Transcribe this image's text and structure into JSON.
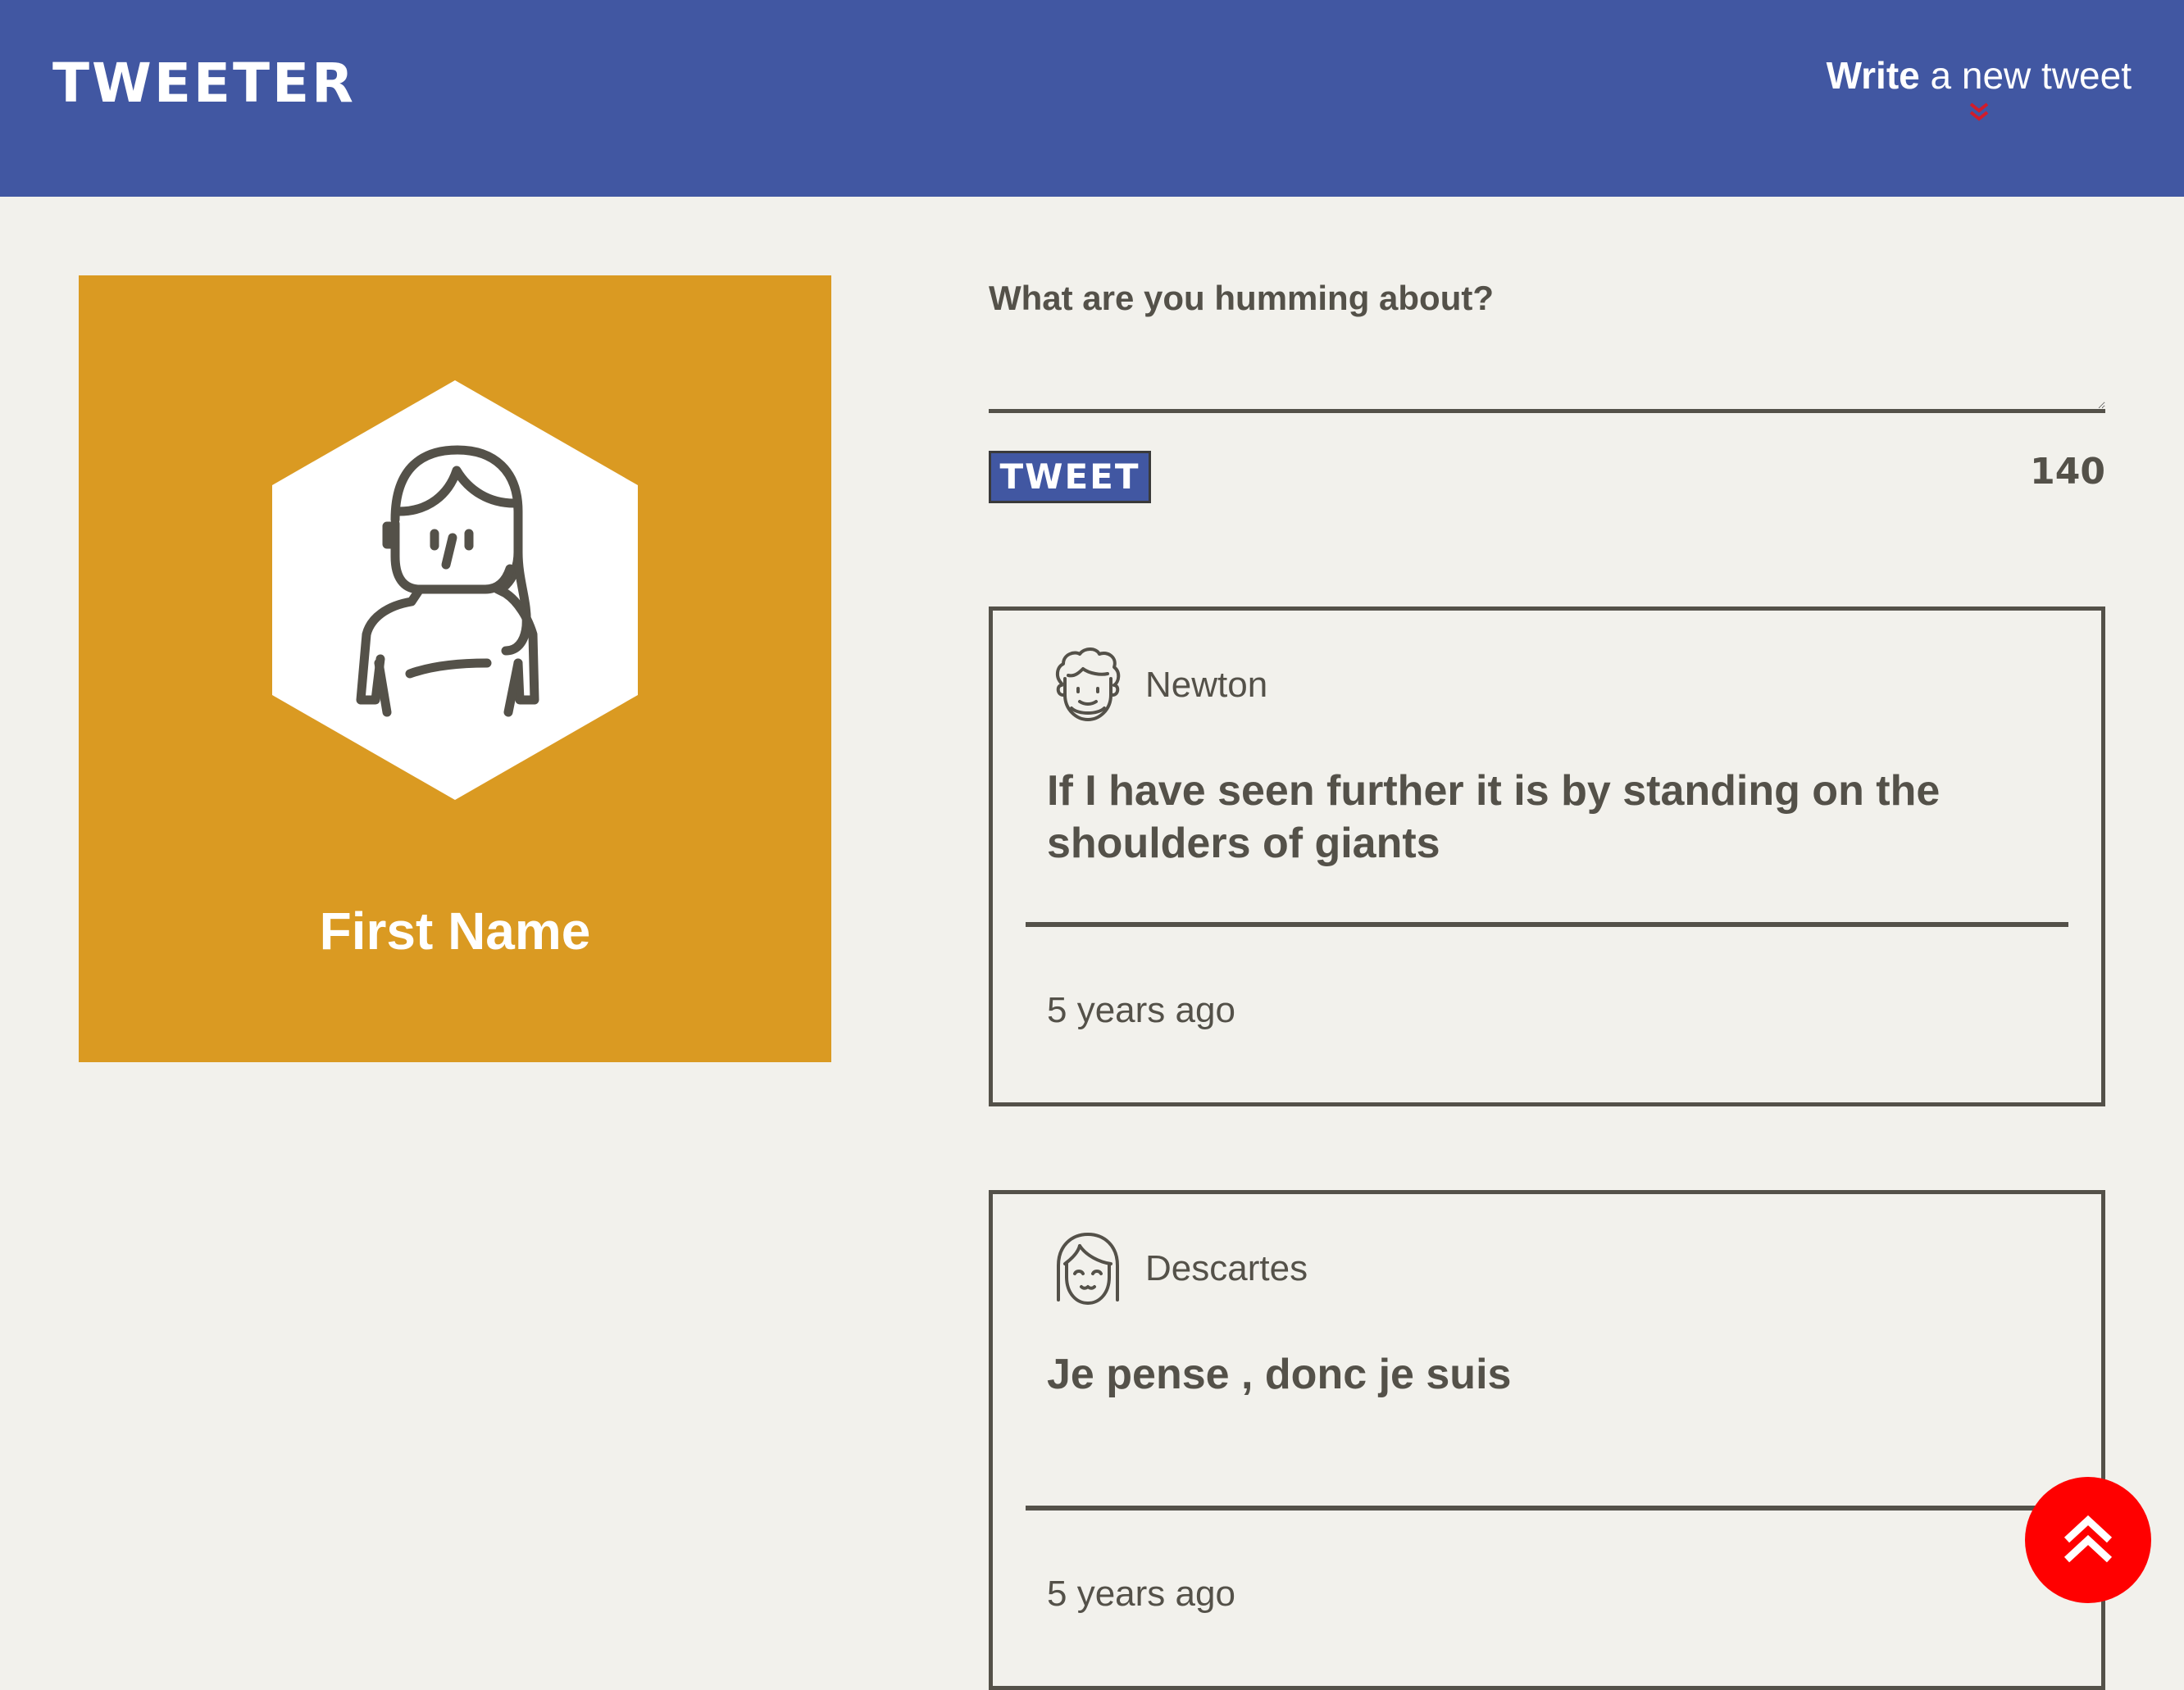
{
  "header": {
    "logo": "TWEETER",
    "compose_bold": "Write",
    "compose_rest": " a new tweet",
    "compose_icon": "chevron-double-down-icon"
  },
  "profile": {
    "name": "First Name",
    "background_color": "#da9a22",
    "avatar_icon": "woman-avatar-icon"
  },
  "composer": {
    "prompt": "What are you humming about?",
    "value": "",
    "placeholder": "",
    "button_label": "TWEET",
    "char_count": "140"
  },
  "tweets": [
    {
      "author": "Newton",
      "avatar_icon": "curly-haired-man-icon",
      "text": "If I have seen further it is by standing on the shoulders of giants",
      "time": "5 years ago"
    },
    {
      "author": "Descartes",
      "avatar_icon": "bob-haired-woman-icon",
      "text": "Je pense , donc je suis",
      "time": "5 years ago"
    }
  ],
  "back_to_top": {
    "icon": "chevron-double-up-icon"
  },
  "colors": {
    "header": "#4157a2",
    "background": "#f2f1ec",
    "text": "#545149",
    "accent_red": "#ff0000",
    "profile": "#da9a22"
  }
}
